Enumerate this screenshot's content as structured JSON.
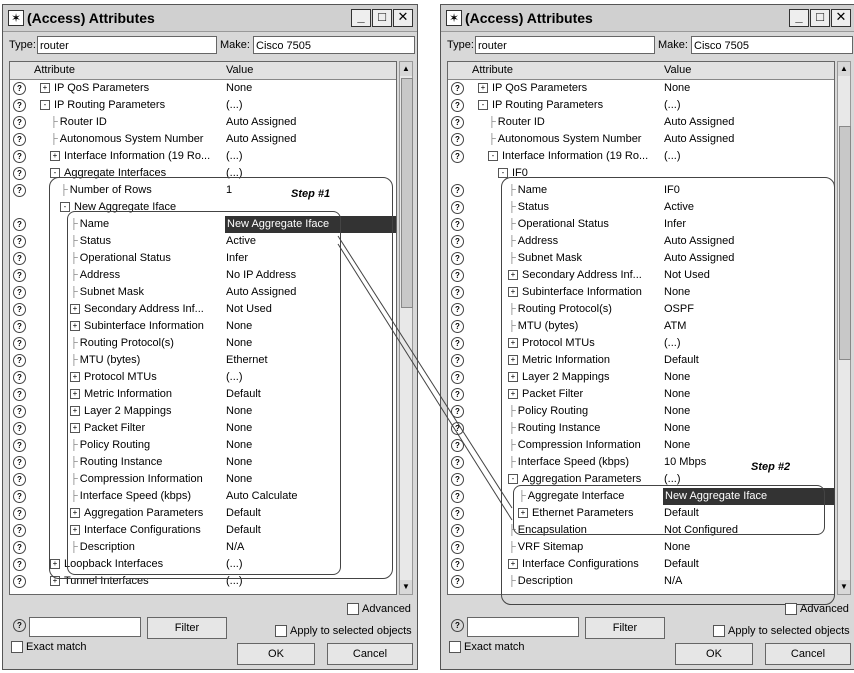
{
  "windows": [
    {
      "title": "(Access) Attributes",
      "type_label": "Type:",
      "type_value": "router",
      "make_label": "Make:",
      "make_value": "Cisco 7505",
      "col_attribute": "Attribute",
      "col_value": "Value",
      "rows": [
        {
          "attr": "IP QoS Parameters",
          "val": "None",
          "tree": "+",
          "lvl": 1
        },
        {
          "attr": "IP Routing Parameters",
          "val": "(...)",
          "tree": "-",
          "lvl": 1
        },
        {
          "attr": "Router ID",
          "val": "Auto Assigned",
          "tree": "leaf",
          "lvl": 2
        },
        {
          "attr": "Autonomous System Number",
          "val": "Auto Assigned",
          "tree": "leaf",
          "lvl": 2
        },
        {
          "attr": "Interface Information (19 Ro...",
          "val": "(...)",
          "tree": "+",
          "lvl": 2
        },
        {
          "attr": "Aggregate Interfaces",
          "val": "(...)",
          "tree": "-",
          "lvl": 2
        },
        {
          "attr": "Number of Rows",
          "val": "1",
          "tree": "leaf",
          "lvl": 3
        },
        {
          "attr": "New Aggregate Iface",
          "val": "",
          "tree": "-",
          "lvl": 3,
          "noq": true
        },
        {
          "attr": "Name",
          "val": "New Aggregate Iface",
          "tree": "leaf",
          "lvl": 4,
          "sel": true
        },
        {
          "attr": "Status",
          "val": "Active",
          "tree": "leaf",
          "lvl": 4
        },
        {
          "attr": "Operational Status",
          "val": "Infer",
          "tree": "leaf",
          "lvl": 4
        },
        {
          "attr": "Address",
          "val": "No IP Address",
          "tree": "leaf",
          "lvl": 4
        },
        {
          "attr": "Subnet Mask",
          "val": "Auto Assigned",
          "tree": "leaf",
          "lvl": 4
        },
        {
          "attr": "Secondary Address Inf...",
          "val": "Not Used",
          "tree": "+",
          "lvl": 4
        },
        {
          "attr": "Subinterface Information",
          "val": "None",
          "tree": "+",
          "lvl": 4
        },
        {
          "attr": "Routing Protocol(s)",
          "val": "None",
          "tree": "leaf",
          "lvl": 4
        },
        {
          "attr": "MTU (bytes)",
          "val": "Ethernet",
          "tree": "leaf",
          "lvl": 4
        },
        {
          "attr": "Protocol MTUs",
          "val": "(...)",
          "tree": "+",
          "lvl": 4
        },
        {
          "attr": "Metric Information",
          "val": "Default",
          "tree": "+",
          "lvl": 4
        },
        {
          "attr": "Layer 2 Mappings",
          "val": "None",
          "tree": "+",
          "lvl": 4
        },
        {
          "attr": "Packet Filter",
          "val": "None",
          "tree": "+",
          "lvl": 4
        },
        {
          "attr": "Policy Routing",
          "val": "None",
          "tree": "leaf",
          "lvl": 4
        },
        {
          "attr": "Routing Instance",
          "val": "None",
          "tree": "leaf",
          "lvl": 4
        },
        {
          "attr": "Compression Information",
          "val": "None",
          "tree": "leaf",
          "lvl": 4
        },
        {
          "attr": "Interface Speed (kbps)",
          "val": "Auto Calculate",
          "tree": "leaf",
          "lvl": 4
        },
        {
          "attr": "Aggregation Parameters",
          "val": "Default",
          "tree": "+",
          "lvl": 4
        },
        {
          "attr": "Interface Configurations",
          "val": "Default",
          "tree": "+",
          "lvl": 4
        },
        {
          "attr": "Description",
          "val": "N/A",
          "tree": "leaf",
          "lvl": 4
        },
        {
          "attr": "Loopback Interfaces",
          "val": "(...)",
          "tree": "+",
          "lvl": 2
        },
        {
          "attr": "Tunnel Interfaces",
          "val": "(...)",
          "tree": "+",
          "lvl": 2
        }
      ],
      "step_label": "Step #1",
      "advanced_label": "Advanced",
      "filter_label": "Filter",
      "apply_label": "Apply to selected objects",
      "exact_label": "Exact match",
      "ok_label": "OK",
      "cancel_label": "Cancel"
    },
    {
      "title": "(Access) Attributes",
      "type_label": "Type:",
      "type_value": "router",
      "make_label": "Make:",
      "make_value": "Cisco 7505",
      "col_attribute": "Attribute",
      "col_value": "Value",
      "rows": [
        {
          "attr": "IP QoS Parameters",
          "val": "None",
          "tree": "+",
          "lvl": 1
        },
        {
          "attr": "IP Routing Parameters",
          "val": "(...)",
          "tree": "-",
          "lvl": 1
        },
        {
          "attr": "Router ID",
          "val": "Auto Assigned",
          "tree": "leaf",
          "lvl": 2
        },
        {
          "attr": "Autonomous System Number",
          "val": "Auto Assigned",
          "tree": "leaf",
          "lvl": 2
        },
        {
          "attr": "Interface Information (19 Ro...",
          "val": "(...)",
          "tree": "-",
          "lvl": 2
        },
        {
          "attr": "IF0",
          "val": "",
          "tree": "-",
          "lvl": 3,
          "noq": true
        },
        {
          "attr": "Name",
          "val": "IF0",
          "tree": "leaf",
          "lvl": 4
        },
        {
          "attr": "Status",
          "val": "Active",
          "tree": "leaf",
          "lvl": 4
        },
        {
          "attr": "Operational Status",
          "val": "Infer",
          "tree": "leaf",
          "lvl": 4
        },
        {
          "attr": "Address",
          "val": "Auto Assigned",
          "tree": "leaf",
          "lvl": 4
        },
        {
          "attr": "Subnet Mask",
          "val": "Auto Assigned",
          "tree": "leaf",
          "lvl": 4
        },
        {
          "attr": "Secondary Address Inf...",
          "val": "Not Used",
          "tree": "+",
          "lvl": 4
        },
        {
          "attr": "Subinterface Information",
          "val": "None",
          "tree": "+",
          "lvl": 4
        },
        {
          "attr": "Routing Protocol(s)",
          "val": "OSPF",
          "tree": "leaf",
          "lvl": 4
        },
        {
          "attr": "MTU (bytes)",
          "val": "ATM",
          "tree": "leaf",
          "lvl": 4
        },
        {
          "attr": "Protocol MTUs",
          "val": "(...)",
          "tree": "+",
          "lvl": 4
        },
        {
          "attr": "Metric Information",
          "val": "Default",
          "tree": "+",
          "lvl": 4
        },
        {
          "attr": "Layer 2 Mappings",
          "val": "None",
          "tree": "+",
          "lvl": 4
        },
        {
          "attr": "Packet Filter",
          "val": "None",
          "tree": "+",
          "lvl": 4
        },
        {
          "attr": "Policy Routing",
          "val": "None",
          "tree": "leaf",
          "lvl": 4
        },
        {
          "attr": "Routing Instance",
          "val": "None",
          "tree": "leaf",
          "lvl": 4
        },
        {
          "attr": "Compression Information",
          "val": "None",
          "tree": "leaf",
          "lvl": 4
        },
        {
          "attr": "Interface Speed (kbps)",
          "val": "10 Mbps",
          "tree": "leaf",
          "lvl": 4
        },
        {
          "attr": "Aggregation Parameters",
          "val": "(...)",
          "tree": "-",
          "lvl": 4
        },
        {
          "attr": "Aggregate Interface",
          "val": "New Aggregate Iface",
          "tree": "leaf",
          "lvl": 5,
          "sel": true
        },
        {
          "attr": "Ethernet Parameters",
          "val": "Default",
          "tree": "+",
          "lvl": 5
        },
        {
          "attr": "Encapsulation",
          "val": "Not Configured",
          "tree": "leaf",
          "lvl": 4
        },
        {
          "attr": "VRF Sitemap",
          "val": "None",
          "tree": "leaf",
          "lvl": 4
        },
        {
          "attr": "Interface Configurations",
          "val": "Default",
          "tree": "+",
          "lvl": 4
        },
        {
          "attr": "Description",
          "val": "N/A",
          "tree": "leaf",
          "lvl": 4
        }
      ],
      "step_label": "Step #2",
      "advanced_label": "Advanced",
      "filter_label": "Filter",
      "apply_label": "Apply to selected objects",
      "exact_label": "Exact match",
      "ok_label": "OK",
      "cancel_label": "Cancel"
    }
  ]
}
